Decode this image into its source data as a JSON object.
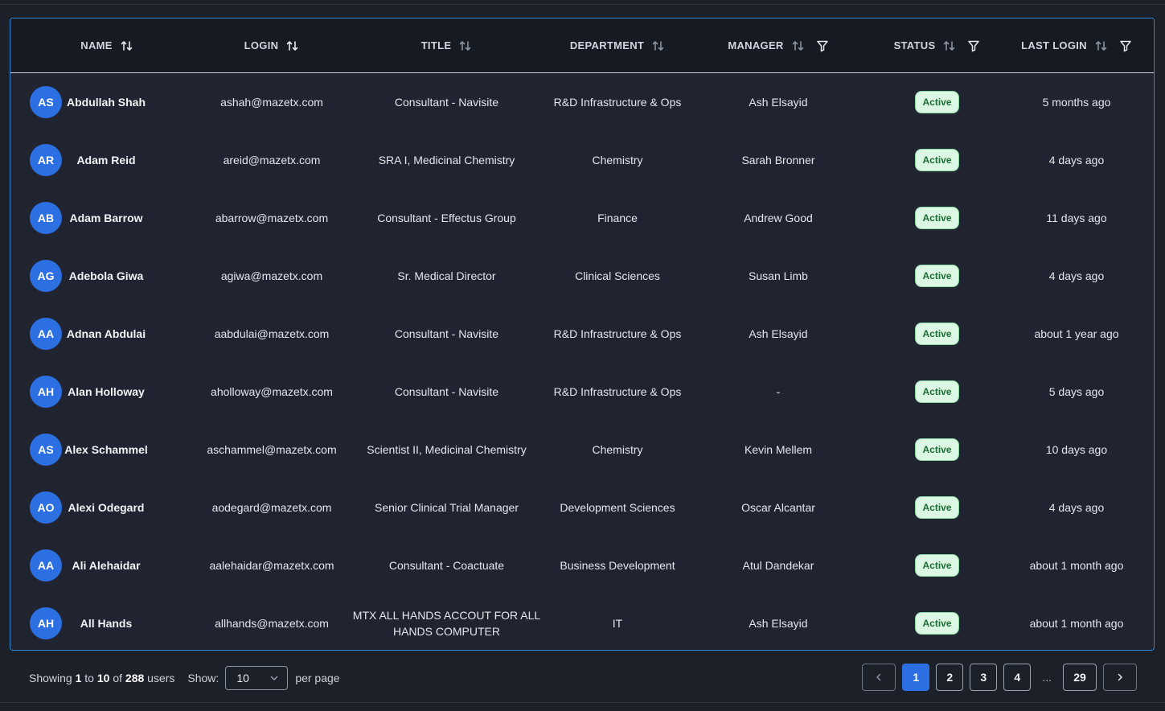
{
  "columns": {
    "name": "NAME",
    "login": "LOGIN",
    "title": "TITLE",
    "department": "DEPARTMENT",
    "manager": "MANAGER",
    "status": "STATUS",
    "last_login": "LAST LOGIN"
  },
  "rows": [
    {
      "initials": "AS",
      "name": "Abdullah Shah",
      "login": "ashah@mazetx.com",
      "title": "Consultant - Navisite",
      "department": "R&D Infrastructure & Ops",
      "manager": "Ash Elsayid",
      "status": "Active",
      "last_login": "5 months ago"
    },
    {
      "initials": "AR",
      "name": "Adam Reid",
      "login": "areid@mazetx.com",
      "title": "SRA I, Medicinal Chemistry",
      "department": "Chemistry",
      "manager": "Sarah Bronner",
      "status": "Active",
      "last_login": "4 days ago"
    },
    {
      "initials": "AB",
      "name": "Adam Barrow",
      "login": "abarrow@mazetx.com",
      "title": "Consultant - Effectus Group",
      "department": "Finance",
      "manager": "Andrew Good",
      "status": "Active",
      "last_login": "11 days ago"
    },
    {
      "initials": "AG",
      "name": "Adebola Giwa",
      "login": "agiwa@mazetx.com",
      "title": "Sr. Medical Director",
      "department": "Clinical Sciences",
      "manager": "Susan Limb",
      "status": "Active",
      "last_login": "4 days ago"
    },
    {
      "initials": "AA",
      "name": "Adnan Abdulai",
      "login": "aabdulai@mazetx.com",
      "title": "Consultant - Navisite",
      "department": "R&D Infrastructure & Ops",
      "manager": "Ash Elsayid",
      "status": "Active",
      "last_login": "about 1 year ago"
    },
    {
      "initials": "AH",
      "name": "Alan Holloway",
      "login": "aholloway@mazetx.com",
      "title": "Consultant - Navisite",
      "department": "R&D Infrastructure & Ops",
      "manager": "-",
      "status": "Active",
      "last_login": "5 days ago"
    },
    {
      "initials": "AS",
      "name": "Alex Schammel",
      "login": "aschammel@mazetx.com",
      "title": "Scientist II, Medicinal Chemistry",
      "department": "Chemistry",
      "manager": "Kevin Mellem",
      "status": "Active",
      "last_login": "10 days ago"
    },
    {
      "initials": "AO",
      "name": "Alexi Odegard",
      "login": "aodegard@mazetx.com",
      "title": "Senior Clinical Trial Manager",
      "department": "Development Sciences",
      "manager": "Oscar Alcantar",
      "status": "Active",
      "last_login": "4 days ago"
    },
    {
      "initials": "AA",
      "name": "Ali Alehaidar",
      "login": "aalehaidar@mazetx.com",
      "title": "Consultant - Coactuate",
      "department": "Business Development",
      "manager": "Atul Dandekar",
      "status": "Active",
      "last_login": "about 1 month ago"
    },
    {
      "initials": "AH",
      "name": "All Hands",
      "login": "allhands@mazetx.com",
      "title": "MTX ALL HANDS ACCOUT FOR ALL HANDS COMPUTER",
      "department": "IT",
      "manager": "Ash Elsayid",
      "status": "Active",
      "last_login": "about 1 month ago"
    }
  ],
  "footer": {
    "showing_prefix": "Showing",
    "range_start": "1",
    "to_word": "to",
    "range_end": "10",
    "of_word": "of",
    "total": "288",
    "users_word": "users",
    "show_label": "Show:",
    "page_size": "10",
    "per_page_label": "per page"
  },
  "pagination": {
    "pages": [
      "1",
      "2",
      "3",
      "4"
    ],
    "ellipsis": "...",
    "last_page": "29",
    "current": "1"
  },
  "colors": {
    "accent": "#2b6fe3",
    "frame": "#2f86d6",
    "badge_bg": "#dcf7e3",
    "badge_text": "#1d6b35"
  }
}
